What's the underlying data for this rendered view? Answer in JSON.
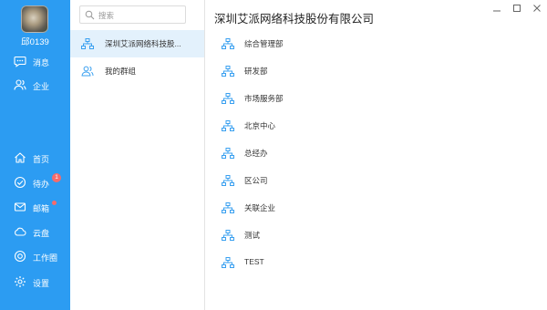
{
  "user": {
    "name": "邱0139"
  },
  "nav": {
    "top": [
      {
        "label": "消息",
        "icon": "chat-icon"
      },
      {
        "label": "企业",
        "icon": "contacts-icon"
      }
    ],
    "bottom": [
      {
        "label": "首页",
        "icon": "home-icon"
      },
      {
        "label": "待办",
        "icon": "check-circle-icon",
        "badge": "1"
      },
      {
        "label": "邮箱",
        "icon": "mail-icon",
        "dot": true
      },
      {
        "label": "云盘",
        "icon": "cloud-icon"
      },
      {
        "label": "工作圈",
        "icon": "circle-target-icon"
      },
      {
        "label": "设置",
        "icon": "gear-icon"
      }
    ]
  },
  "search": {
    "placeholder": "搜索"
  },
  "org_list": [
    {
      "label": "深圳艾派网络科技股...",
      "icon": "org-tree-icon",
      "active": true
    },
    {
      "label": "我的群组",
      "icon": "group-icon",
      "active": false
    }
  ],
  "main": {
    "title": "深圳艾派网络科技股份有限公司",
    "departments": [
      "综合管理部",
      "研发部",
      "市场服务部",
      "北京中心",
      "总经办",
      "区公司",
      "关联企业",
      "测试",
      "TEST"
    ]
  },
  "colors": {
    "rail": "#2c9cf2",
    "accent": "#3aa0f0",
    "active_row": "#e3f1fc",
    "badge": "#f56b6b"
  }
}
